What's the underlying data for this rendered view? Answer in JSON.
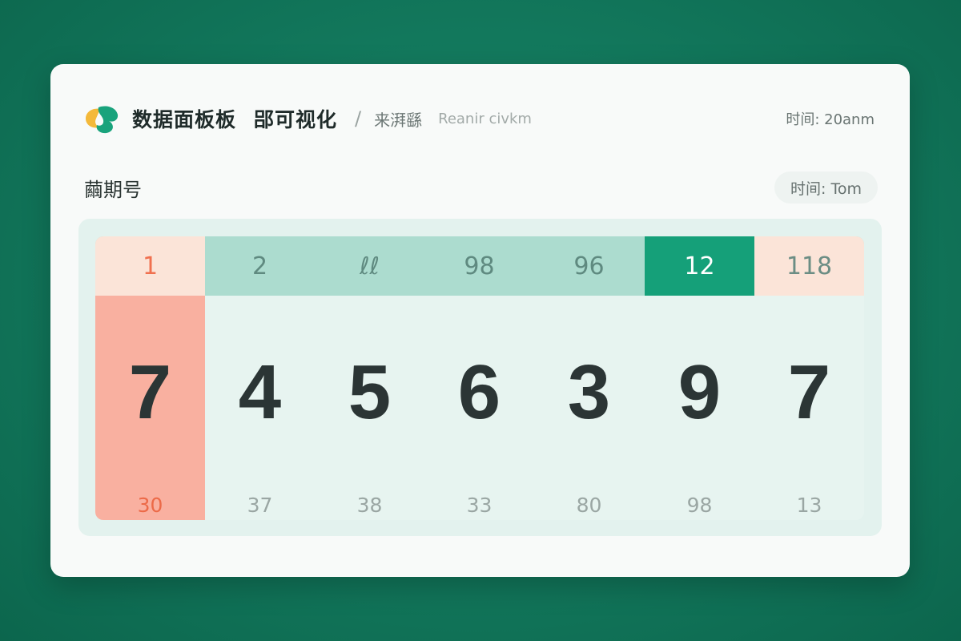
{
  "header": {
    "app_title": "数据面板板",
    "subtitle": "郘可视化",
    "slash": "/",
    "breadcrumb_cn": "来湃繇",
    "breadcrumb_en": "Reanir civkm",
    "time": "时间: 20anm"
  },
  "section": {
    "title": "繭期号",
    "time_pill": "时间: Tom"
  },
  "columns": [
    {
      "head": "1",
      "big": "7",
      "foot": "30"
    },
    {
      "head": "2",
      "big": "4",
      "foot": "37"
    },
    {
      "head": "ℓℓ",
      "big": "5",
      "foot": "38"
    },
    {
      "head": "98",
      "big": "6",
      "foot": "33"
    },
    {
      "head": "96",
      "big": "3",
      "foot": "80"
    },
    {
      "head": "12",
      "big": "9",
      "foot": "98"
    },
    {
      "head": "118",
      "big": "7",
      "foot": "13"
    }
  ],
  "colors": {
    "background": "#137a5e",
    "accent_green": "#15a079",
    "header_mint": "#acdccf",
    "highlight_coral": "#f9b0a0",
    "highlight_peach": "#fbe4d8",
    "coral_text": "#f0704f"
  },
  "icons": {
    "logo": "app-logo-icon"
  }
}
